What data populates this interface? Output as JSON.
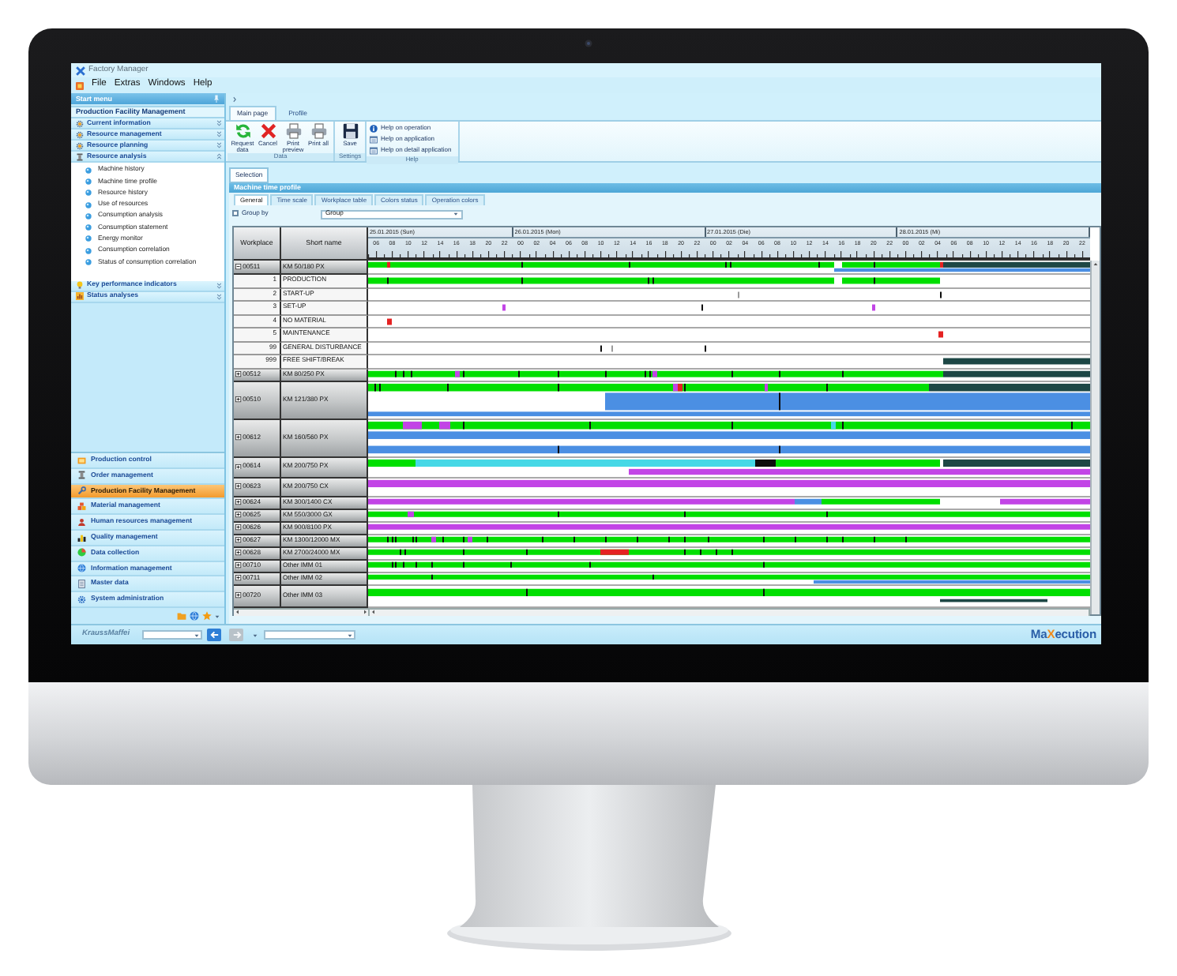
{
  "window": {
    "title": "Factory Manager"
  },
  "menu": [
    {
      "label": "File"
    },
    {
      "label": "Extras"
    },
    {
      "label": "Windows"
    },
    {
      "label": "Help"
    }
  ],
  "sidebar": {
    "header": "Start menu",
    "section": "Production Facility Management",
    "groups": [
      {
        "label": "Current information",
        "expanded": false
      },
      {
        "label": "Resource management",
        "expanded": false
      },
      {
        "label": "Resource planning",
        "expanded": false
      },
      {
        "label": "Resource analysis",
        "expanded": true,
        "children": [
          {
            "label": "Machine history"
          },
          {
            "label": "Machine time profile"
          },
          {
            "label": "Resource history"
          },
          {
            "label": "Use of resources"
          },
          {
            "label": "Consumption analysis"
          },
          {
            "label": "Consumption statement"
          },
          {
            "label": "Energy monitor"
          },
          {
            "label": "Consumption correlation"
          },
          {
            "label": "Status of consumption correlation"
          }
        ]
      },
      {
        "label": "Key performance indicators",
        "expanded": false
      },
      {
        "label": "Status analyses",
        "expanded": false
      }
    ],
    "modules": [
      {
        "label": "Production control",
        "selected": false
      },
      {
        "label": "Order management",
        "selected": false
      },
      {
        "label": "Production Facility Management",
        "selected": true
      },
      {
        "label": "Material management",
        "selected": false
      },
      {
        "label": "Human resources management",
        "selected": false
      },
      {
        "label": "Quality management",
        "selected": false
      },
      {
        "label": "Data collection",
        "selected": false
      },
      {
        "label": "Information management",
        "selected": false
      },
      {
        "label": "Master data",
        "selected": false
      },
      {
        "label": "System administration",
        "selected": false
      }
    ]
  },
  "ribbon": {
    "tabs": [
      {
        "label": "Main page",
        "selected": true
      },
      {
        "label": "Profile",
        "selected": false
      }
    ],
    "groups": [
      {
        "label": "Data",
        "kind": "large",
        "buttons": [
          {
            "label": "Request data"
          },
          {
            "label": "Cancel"
          },
          {
            "label": "Print preview"
          },
          {
            "label": "Print all"
          }
        ]
      },
      {
        "label": "Settings",
        "kind": "large",
        "buttons": [
          {
            "label": "Save"
          }
        ]
      },
      {
        "label": "Help",
        "kind": "small",
        "buttons": [
          {
            "label": "Help on operation"
          },
          {
            "label": "Help on application"
          },
          {
            "label": "Help on detail application"
          }
        ]
      }
    ]
  },
  "selection_tabs": [
    {
      "label": "Selection",
      "selected": true
    }
  ],
  "panel": {
    "title": "Machine time profile",
    "tabs": [
      {
        "label": "General",
        "selected": true
      },
      {
        "label": "Time scale",
        "selected": false
      },
      {
        "label": "Workplace table",
        "selected": false
      },
      {
        "label": "Colors status",
        "selected": false
      },
      {
        "label": "Operation colors",
        "selected": false
      }
    ],
    "group_by": {
      "label": "Group by",
      "checked": false,
      "value": "Group"
    },
    "table": {
      "columns": [
        "Workplace",
        "Short name"
      ],
      "days": [
        {
          "label": "25.01.2015 (Sun)",
          "hours": [
            "06",
            "08",
            "10",
            "12",
            "14",
            "16",
            "18",
            "20",
            "22"
          ]
        },
        {
          "label": "26.01.2015 (Mon)",
          "hours": [
            "00",
            "02",
            "04",
            "06",
            "08",
            "10",
            "12",
            "14",
            "16",
            "18",
            "20",
            "22"
          ]
        },
        {
          "label": "27.01.2015 (Die)",
          "hours": [
            "00",
            "02",
            "04",
            "06",
            "08",
            "10",
            "12",
            "14",
            "16",
            "18",
            "20",
            "22"
          ]
        },
        {
          "label": "28.01.2015 (Mi)",
          "hours": [
            "00",
            "02",
            "04",
            "06",
            "08",
            "10",
            "12",
            "14",
            "16",
            "18",
            "20",
            "22"
          ]
        }
      ],
      "rows": [
        {
          "kind": "machine",
          "workplace": "00511",
          "short_name": "KM 50/180 PX",
          "expanded": true
        },
        {
          "kind": "status",
          "code": "1",
          "name": "PRODUCTION"
        },
        {
          "kind": "status",
          "code": "2",
          "name": "START-UP"
        },
        {
          "kind": "status",
          "code": "3",
          "name": "SET-UP"
        },
        {
          "kind": "status",
          "code": "4",
          "name": "NO MATERIAL"
        },
        {
          "kind": "status",
          "code": "5",
          "name": "MAINTENANCE"
        },
        {
          "kind": "status",
          "code": "99",
          "name": "GENERAL DISTURBANCE"
        },
        {
          "kind": "status",
          "code": "999",
          "name": "FREE SHIFT/BREAK"
        },
        {
          "kind": "machine",
          "workplace": "00512",
          "short_name": "KM 80/250 PX",
          "expanded": false
        },
        {
          "kind": "machine",
          "workplace": "00510",
          "short_name": "KM 121/380 PX",
          "expanded": false
        },
        {
          "kind": "machine",
          "workplace": "00612",
          "short_name": "KM 160/560 PX",
          "expanded": false
        },
        {
          "kind": "machine",
          "workplace": "00614",
          "short_name": "KM 200/750 PX",
          "expanded": false
        },
        {
          "kind": "machine",
          "workplace": "00623",
          "short_name": "KM 200/750 CX",
          "expanded": false
        },
        {
          "kind": "machine",
          "workplace": "00624",
          "short_name": "KM 300/1400 CX",
          "expanded": false
        },
        {
          "kind": "machine",
          "workplace": "00625",
          "short_name": "KM 550/3000 GX",
          "expanded": false
        },
        {
          "kind": "machine",
          "workplace": "00626",
          "short_name": "KM 900/8100 PX",
          "expanded": false
        },
        {
          "kind": "machine",
          "workplace": "00627",
          "short_name": "KM 1300/12000 MX",
          "expanded": false
        },
        {
          "kind": "machine",
          "workplace": "00628",
          "short_name": "KM 2700/24000 MX",
          "expanded": false
        },
        {
          "kind": "machine",
          "workplace": "00710",
          "short_name": "Other IMM 01",
          "expanded": false
        },
        {
          "kind": "machine",
          "workplace": "00711",
          "short_name": "Other IMM 02",
          "expanded": false
        },
        {
          "kind": "machine",
          "workplace": "00720",
          "short_name": "Other IMM 03",
          "expanded": false
        }
      ]
    }
  },
  "status_bar": {
    "company": "KraussMaffei",
    "product_logo": [
      {
        "text": "Ma",
        "accent": false
      },
      {
        "text": "X",
        "accent": true
      },
      {
        "text": "ecution",
        "accent": false
      }
    ]
  }
}
